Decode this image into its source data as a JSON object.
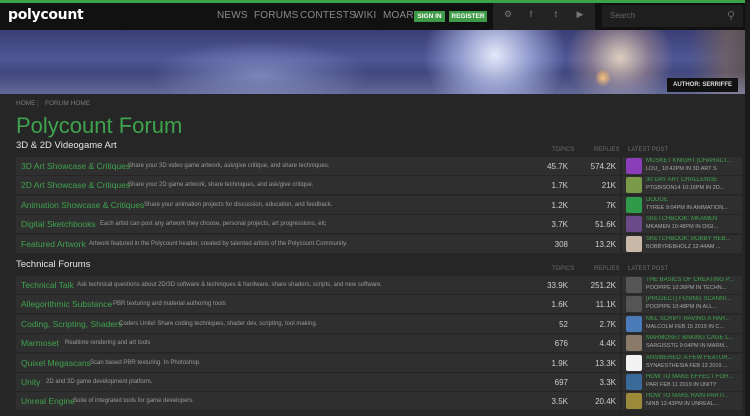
{
  "header": {
    "logo": "polycount",
    "nav": [
      "NEWS",
      "FORUMS",
      "CONTESTS",
      "WIKI",
      "MOAR"
    ],
    "sign_in": "SIGN IN",
    "register": "REGISTER",
    "search_placeholder": "Search",
    "social_icons": [
      "steam-icon",
      "facebook-icon",
      "twitter-icon",
      "youtube-icon"
    ],
    "accent_color": "#3aa34a"
  },
  "banner": {
    "author": "AUTHOR: SERRIFFE"
  },
  "breadcrumb": [
    "HOME",
    "FORUM HOME"
  ],
  "page_title": "Polycount Forum",
  "columns": {
    "topics": "TOPICS",
    "replies": "REPLIES",
    "latest": "LATEST POST"
  },
  "sections": [
    {
      "title": "3D & 2D Videogame Art",
      "forums": [
        {
          "name": "3D Art Showcase & Critiques",
          "desc": "Share your 3D video game artwork, ask/give critique, and share techniques.",
          "topics": "45.7K",
          "replies": "574.2K",
          "latest_title": "MUSKET KNIGHT [CHARACT...",
          "latest_meta": "LOU_  10:42PM  IN 3D ART S",
          "avatar_color": "#8a3db8"
        },
        {
          "name": "2D Art Showcase & Critiques",
          "desc": "Share your 2D game artwork, share techniques, and ask/give critique.",
          "topics": "1.7K",
          "replies": "21K",
          "latest_title": "30 DAY ART CHALLENGE",
          "latest_meta": "PTGBISON14  10:16PM  IN 2D...",
          "avatar_color": "#7a9a4a"
        },
        {
          "name": "Animation Showcase & Critiques",
          "desc": "Share your animation projects for discussion, education, and feedback.",
          "topics": "1.2K",
          "replies": "7K",
          "latest_title": "DODGE",
          "latest_meta": "TYREE  9:04PM  IN ANIMATION...",
          "avatar_color": "#2e9a4a"
        },
        {
          "name": "Digital Sketchbooks",
          "desc": "Each artist can post any artwork they choose, personal projects, art progressions, etc",
          "topics": "3.7K",
          "replies": "51.6K",
          "latest_title": "SKETCHBOOK: MKAMEN",
          "latest_meta": "MKAMEN  10:48PM  IN DIGI...",
          "avatar_color": "#6a4a8a"
        },
        {
          "name": "Featured Artwork",
          "desc": "Artwork featured in the Polycount header, created by talented artists of the Polycount Community.",
          "topics": "308",
          "replies": "13.2K",
          "latest_title": "SKETCHBOOK: BOBBY REB...",
          "latest_meta": "BOBBYREBHOLZ  12:44AM  ...",
          "avatar_color": "#c8b8a8"
        }
      ]
    },
    {
      "title": "Technical Forums",
      "forums": [
        {
          "name": "Technical Talk",
          "desc": "Ask technical questions about 2D/3D software & techniques & hardware, share shaders, scripts, and new software.",
          "topics": "33.9K",
          "replies": "251.2K",
          "latest_title": "THE BASICS OF CREATING P...",
          "latest_meta": "POOPIPE  10:36PM  IN TECHN...",
          "avatar_color": "#555555"
        },
        {
          "name": "Allegorithmic Substance",
          "desc": "PBR texturing and material authoring tools",
          "topics": "1.6K",
          "replies": "11.1K",
          "latest_title": "[PROJECT] FUSING SCANNI...",
          "latest_meta": "POOPIPE  10:48PM  IN ALL...",
          "avatar_color": "#555555"
        },
        {
          "name": "Coding, Scripting, Shaders",
          "desc": "Coders Unite! Share coding techniques, shader dev, scripting, tool making.",
          "topics": "52",
          "replies": "2.7K",
          "latest_title": "MEL SCRIPT HAVING A HAR...",
          "latest_meta": "MALCOLM  FEB 15 2019  IN C...",
          "avatar_color": "#4a7ab8"
        },
        {
          "name": "Marmoset",
          "desc": "Realtime rendering and art tools",
          "topics": "676",
          "replies": "4.4K",
          "latest_title": "MARMOSET BAKING CAGE L...",
          "latest_meta": "SARGISSTG  9:04PM  IN MARM...",
          "avatar_color": "#8a7a6a"
        },
        {
          "name": "Quixel Megascans",
          "desc": "Scan based PBR texturing. In Photoshop.",
          "topics": "1.9K",
          "replies": "13.3K",
          "latest_title": "ANSWERED: A FEW FEATUR...",
          "latest_meta": "SYNAESTHESIA  FEB 13 2019 ...",
          "avatar_color": "#f2f2f2"
        },
        {
          "name": "Unity",
          "desc": "2D and 3D game development platform.",
          "topics": "697",
          "replies": "3.3K",
          "latest_title": "HOW TO MAKE EFFECT FOR...",
          "latest_meta": "PARI  FEB 11 2019  IN UNITY",
          "avatar_color": "#3a6a9a"
        },
        {
          "name": "Unreal Engine",
          "desc": "Suite of integrated tools for game developers.",
          "topics": "3.5K",
          "replies": "20.4K",
          "latest_title": "HOW TO MAKE RAIN PARTI...",
          "latest_meta": "NINB  12:43PM  IN UNREAL...",
          "avatar_color": "#9a8a3a"
        }
      ]
    }
  ]
}
